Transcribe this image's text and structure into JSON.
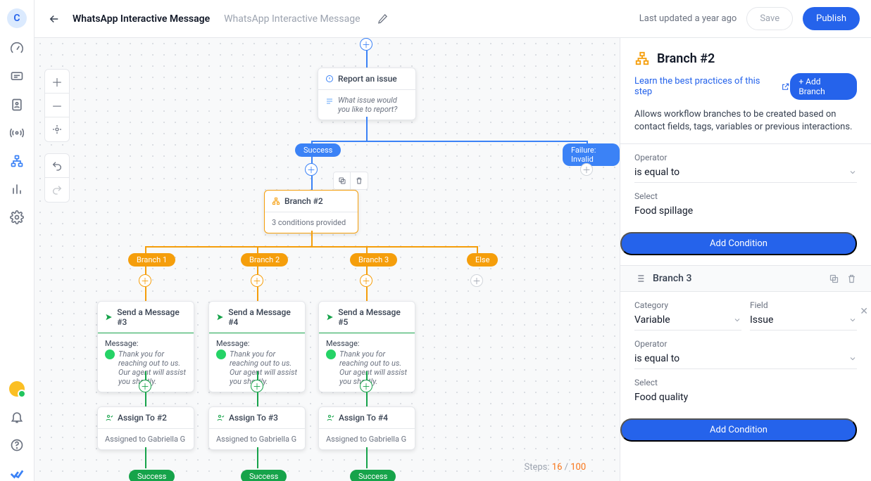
{
  "avatar": "C",
  "header": {
    "title": "WhatsApp Interactive Message",
    "subtitle": "WhatsApp Interactive Message",
    "updated": "Last updated a year ago",
    "save": "Save",
    "publish": "Publish"
  },
  "steps": {
    "label": "Steps:",
    "current": "16",
    "total": "100"
  },
  "nodes": {
    "report": {
      "title": "Report an issue",
      "body": "What issue would you like to report?"
    },
    "success": "Success",
    "failure": "Failure: Invalid",
    "branch": {
      "title": "Branch #2",
      "body": "3 conditions provided"
    },
    "b1": "Branch 1",
    "b2": "Branch 2",
    "b3": "Branch 3",
    "else": "Else",
    "msg3": {
      "title": "Send a Message #3",
      "label": "Message:",
      "body": "Thank you for reaching out to us. Our agent will assist you shortly."
    },
    "msg4": {
      "title": "Send a Message #4",
      "label": "Message:",
      "body": "Thank you for reaching out to us. Our agent will assist you shortly."
    },
    "msg5": {
      "title": "Send a Message #5",
      "label": "Message:",
      "body": "Thank you for reaching out to us. Our agent will assist you shortly."
    },
    "assign2": {
      "title": "Assign To #2",
      "body": "Assigned to Gabriella G"
    },
    "assign3": {
      "title": "Assign To #3",
      "body": "Assigned to Gabriella G"
    },
    "assign4": {
      "title": "Assign To #4",
      "body": "Assigned to Gabriella G"
    },
    "succ_b": "Success"
  },
  "inspector": {
    "title": "Branch #2",
    "learn": "Learn the best practices of this step",
    "addBranch": "+ Add Branch",
    "desc": "Allows workflow branches to be created based on contact fields, tags, variables or previous interactions.",
    "cond1": {
      "operatorLabel": "Operator",
      "operator": "is equal to",
      "selectLabel": "Select",
      "select": "Food spillage",
      "addCond": "Add Condition"
    },
    "branch3": {
      "name": "Branch 3",
      "categoryLabel": "Category",
      "category": "Variable",
      "fieldLabel": "Field",
      "field": "Issue",
      "operatorLabel": "Operator",
      "operator": "is equal to",
      "selectLabel": "Select",
      "select": "Food quality",
      "addCond": "Add Condition"
    }
  }
}
